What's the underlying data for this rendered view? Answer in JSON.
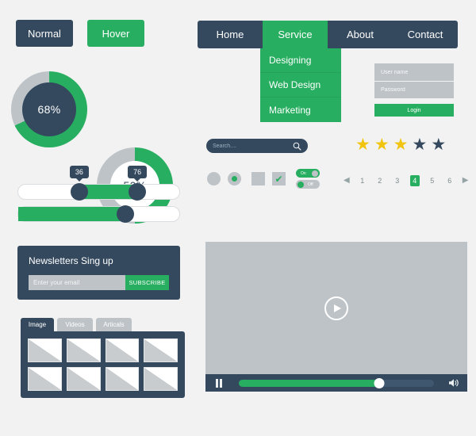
{
  "theme": {
    "bg": "#f2f2f2",
    "navy": "#34495e",
    "green": "#27ae60",
    "gray": "#bdc3c7",
    "yellow": "#f1c40f"
  },
  "buttons": {
    "normal_label": "Normal",
    "hover_label": "Hover"
  },
  "donuts": [
    {
      "label": "68%",
      "value": 68,
      "style": "filled"
    },
    {
      "label": "50%",
      "value": 50,
      "style": "hollow"
    }
  ],
  "sliders": [
    {
      "low_label": "36",
      "low_value": 36,
      "high_label": "76",
      "high_value": 76,
      "type": "range"
    },
    {
      "value": 68,
      "type": "single"
    }
  ],
  "newsletter": {
    "title": "Newsletters Sing up",
    "email_placeholder": "Enter your email",
    "email_value": "",
    "subscribe_label": "SUBSCRIBE"
  },
  "gallery": {
    "tabs": [
      {
        "label": "Image",
        "active": true
      },
      {
        "label": "Videos",
        "active": false
      },
      {
        "label": "Articals",
        "active": false
      }
    ],
    "thumb_count": 8
  },
  "nav": {
    "items": [
      {
        "label": "Home",
        "active": false
      },
      {
        "label": "Service",
        "active": true
      },
      {
        "label": "About",
        "active": false
      },
      {
        "label": "Contact",
        "active": false
      }
    ],
    "submenu": [
      {
        "label": "Designing"
      },
      {
        "label": "Web Design"
      },
      {
        "label": "Marketing"
      }
    ]
  },
  "login": {
    "username_placeholder": "User name",
    "username_value": "",
    "password_placeholder": "Password",
    "password_value": "",
    "login_label": "Login"
  },
  "search": {
    "placeholder": "Search....",
    "value": "",
    "icon": "search-icon"
  },
  "controls": {
    "radio_off_checked": false,
    "radio_on_checked": true,
    "checkbox_off_checked": false,
    "checkbox_on_checked": true,
    "check_glyph": "✔",
    "toggle_on_label": "On",
    "toggle_off_label": "Off"
  },
  "rating": {
    "filled": 3,
    "total": 5,
    "glyph": "★"
  },
  "pagination": {
    "prev_glyph": "◀",
    "next_glyph": "▶",
    "pages": [
      "1",
      "2",
      "3",
      "4",
      "5",
      "6"
    ],
    "active_page": "4"
  },
  "video": {
    "play_icon": "play-icon",
    "pause_icon": "pause-icon",
    "volume_icon": "volume-icon",
    "volume_glyph": "🔊",
    "progress_percent": 72
  }
}
